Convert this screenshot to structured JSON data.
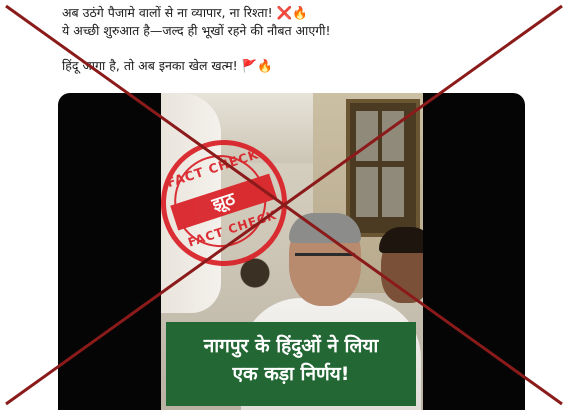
{
  "post": {
    "line1": "अब उठंगे पैजामे वालों से ना व्यापार, ना रिश्ता!",
    "line1_emoji_x": "❌",
    "line1_emoji_fire": "🔥",
    "line2": "ये अच्छी शुरुआत है—जल्द ही भूखों रहने की नौबत आएगी!",
    "line3": "हिंदू जागा है, तो अब इनका खेल खत्म!",
    "line3_emoji_flag": "🚩",
    "line3_emoji_fire": "🔥"
  },
  "video": {
    "caption_line1": "नागपुर के हिंदुओं ने लिया",
    "caption_line2": "एक कड़ा निर्णय!",
    "caption_bg": "#226734"
  },
  "stamp": {
    "top_text": "FACT CHECK",
    "band_text": "झूठ",
    "bottom_text": "FACT CHECK",
    "color": "#d91f26"
  },
  "overlay": {
    "cross_color": "#8b1a1a"
  }
}
